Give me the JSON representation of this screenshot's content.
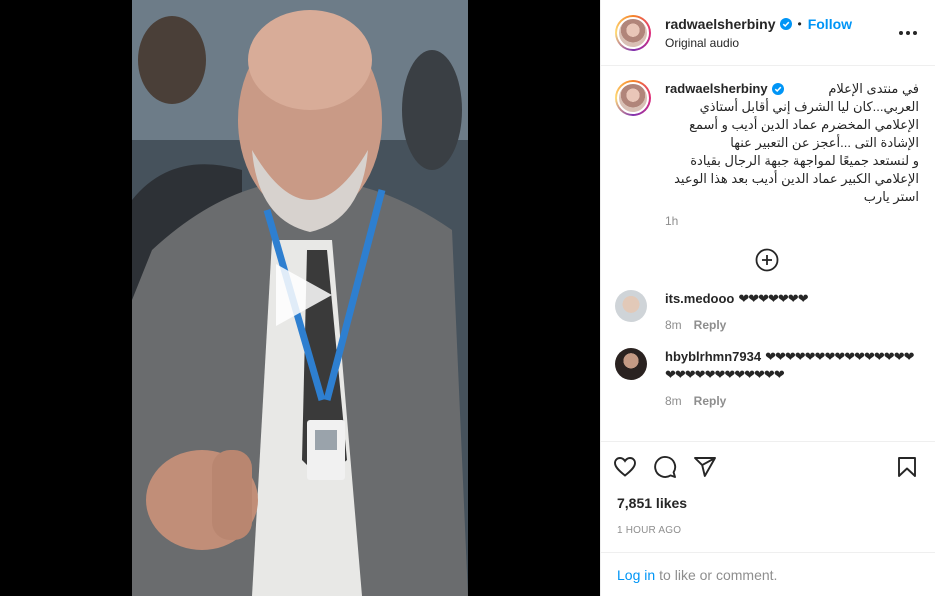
{
  "post": {
    "author": "radwaelsherbiny",
    "follow_label": "Follow",
    "dot": "•",
    "audio": "Original audio"
  },
  "caption": {
    "username": "radwaelsherbiny",
    "text": "في منتدى الإعلام العربي...كان ليا الشرف إني أقابل أستاذي الإعلامي المخضرم عماد الدين أديب و أسمع الإشادة التى ...أعجز عن التعبير عنها\nو لنستعد جميعًا لمواجهة جبهة الرجال بقيادة الإعلامي الكبير عماد الدين أديب بعد هذا الوعيد استر يارب",
    "time": "1h"
  },
  "comments": [
    {
      "username": "its.medooo",
      "text": "❤❤❤❤❤❤❤",
      "time": "8m",
      "reply_label": "Reply"
    },
    {
      "username": "hbyblrhmn7934",
      "text": "❤❤❤❤❤❤❤❤❤❤❤❤❤❤❤❤❤❤❤❤❤❤❤❤❤❤❤",
      "time": "8m",
      "reply_label": "Reply"
    }
  ],
  "stats": {
    "likes": "7,851 likes",
    "posted_ago": "1 HOUR AGO"
  },
  "login": {
    "link": "Log in",
    "rest": "to like or comment."
  },
  "icons": {
    "like": "heart-icon",
    "comment": "comment-icon",
    "share": "paper-plane-icon",
    "save": "bookmark-icon",
    "play": "play-icon",
    "more": "more-options-icon",
    "verified": "verified-badge-icon",
    "load_more": "plus-circle-icon"
  },
  "colors": {
    "accent": "#0095f6",
    "secondary_text": "#8e8e8e",
    "verified": "#0095f6"
  }
}
